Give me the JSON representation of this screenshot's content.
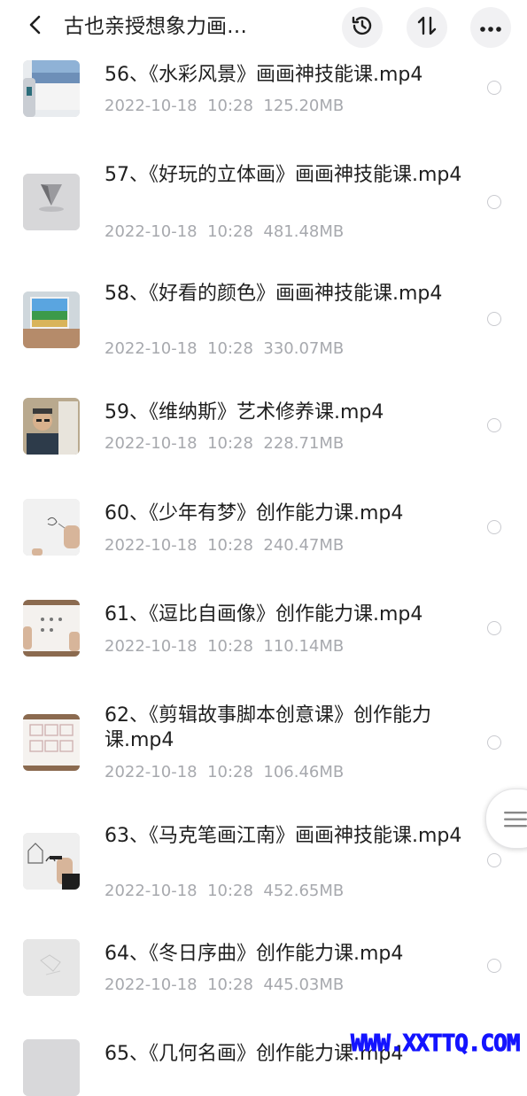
{
  "header": {
    "title": "古也亲授想象力画…"
  },
  "files": [
    {
      "name": "56、《水彩风景》画画神技能课.mp4",
      "date": "2022-10-18",
      "time": "10:28",
      "size": "125.20MB",
      "thumb_icon": "watercolor-landscape-thumbnail"
    },
    {
      "name": "57、《好玩的立体画》画画神技能课.mp4",
      "date": "2022-10-18",
      "time": "10:28",
      "size": "481.48MB",
      "thumb_icon": "3d-drawing-thumbnail"
    },
    {
      "name": "58、《好看的颜色》画画神技能课.mp4",
      "date": "2022-10-18",
      "time": "10:28",
      "size": "330.07MB",
      "thumb_icon": "color-painting-thumbnail"
    },
    {
      "name": "59、《维纳斯》艺术修养课.mp4",
      "date": "2022-10-18",
      "time": "10:28",
      "size": "228.71MB",
      "thumb_icon": "teacher-venus-thumbnail"
    },
    {
      "name": "60、《少年有梦》创作能力课.mp4",
      "date": "2022-10-18",
      "time": "10:28",
      "size": "240.47MB",
      "thumb_icon": "sketch-paper-thumbnail"
    },
    {
      "name": "61、《逗比自画像》创作能力课.mp4",
      "date": "2022-10-18",
      "time": "10:28",
      "size": "110.14MB",
      "thumb_icon": "self-portrait-thumbnail"
    },
    {
      "name": "62、《剪辑故事脚本创意课》创作能力课.mp4",
      "date": "2022-10-18",
      "time": "10:28",
      "size": "106.46MB",
      "thumb_icon": "storyboard-thumbnail"
    },
    {
      "name": "63、《马克笔画江南》画画神技能课.mp4",
      "date": "2022-10-18",
      "time": "10:28",
      "size": "452.65MB",
      "thumb_icon": "marker-drawing-thumbnail"
    },
    {
      "name": "64、《冬日序曲》创作能力课.mp4",
      "date": "2022-10-18",
      "time": "10:28",
      "size": "445.03MB",
      "thumb_icon": "winter-drawing-thumbnail"
    },
    {
      "name": "65、《几何名画》创作能力课.mp4",
      "date": "",
      "time": "",
      "size": "",
      "thumb_icon": "geometry-painting-thumbnail"
    }
  ],
  "watermark": "WWW.XXTTQ.COM",
  "colors": {
    "text": "#1f1f1f",
    "meta": "#a7a9ae",
    "header_button_bg": "#f1f1f3",
    "watermark": "#1414ff"
  }
}
